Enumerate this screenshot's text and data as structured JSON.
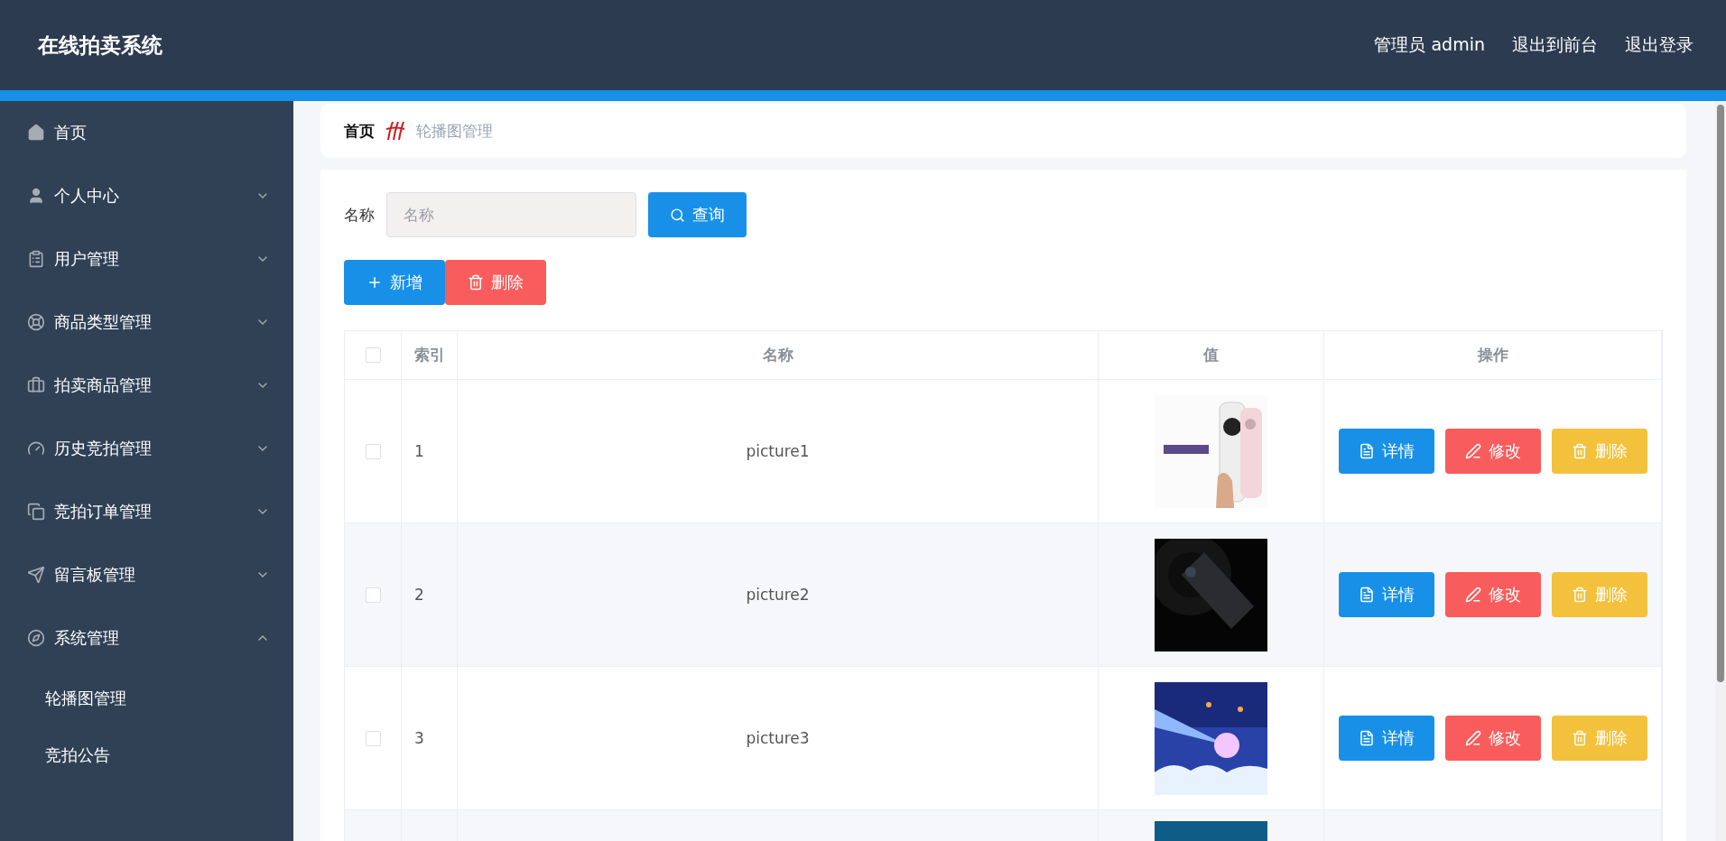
{
  "header": {
    "title": "在线拍卖系统",
    "links": [
      "管理员 admin",
      "退出到前台",
      "退出登录"
    ]
  },
  "sidebar": {
    "items": [
      {
        "label": "首页"
      },
      {
        "label": "个人中心",
        "expanded": false
      },
      {
        "label": "用户管理",
        "expanded": false
      },
      {
        "label": "商品类型管理",
        "expanded": false
      },
      {
        "label": "拍卖商品管理",
        "expanded": false
      },
      {
        "label": "历史竞拍管理",
        "expanded": false
      },
      {
        "label": "竞拍订单管理",
        "expanded": false
      },
      {
        "label": "留言板管理",
        "expanded": false
      },
      {
        "label": "系统管理",
        "expanded": true,
        "children": [
          {
            "label": "轮播图管理"
          },
          {
            "label": "竞拍公告"
          }
        ]
      }
    ]
  },
  "breadcrumb": {
    "home": "首页",
    "current": "轮播图管理"
  },
  "search": {
    "label": "名称",
    "placeholder": "名称",
    "button": "查询"
  },
  "actions": [
    {
      "kind": "add",
      "label": "新增"
    },
    {
      "kind": "delete",
      "label": "删除"
    }
  ],
  "table": {
    "header_checked": false,
    "columns": [
      "索引",
      "名称",
      "值",
      "操作"
    ],
    "rows": [
      {
        "checked": false,
        "index": "1",
        "name": "picture1",
        "picture": {
          "kind": "picture"
        },
        "buttons": [
          {
            "kind": "detail",
            "label": "详情"
          },
          {
            "kind": "edit",
            "label": "修改"
          },
          {
            "kind": "delete",
            "label": "删除"
          }
        ]
      },
      {
        "checked": false,
        "index": "2",
        "name": "picture2",
        "picture": {
          "kind": "picture"
        },
        "buttons": [
          {
            "kind": "detail",
            "label": "详情"
          },
          {
            "kind": "edit",
            "label": "修改"
          },
          {
            "kind": "delete",
            "label": "删除"
          }
        ]
      },
      {
        "checked": false,
        "index": "3",
        "name": "picture3",
        "picture": {
          "kind": "picture"
        },
        "buttons": [
          {
            "kind": "detail",
            "label": "详情"
          },
          {
            "kind": "edit",
            "label": "修改"
          },
          {
            "kind": "delete",
            "label": "删除"
          }
        ]
      },
      {
        "picture": {
          "kind": "picture"
        }
      }
    ]
  }
}
